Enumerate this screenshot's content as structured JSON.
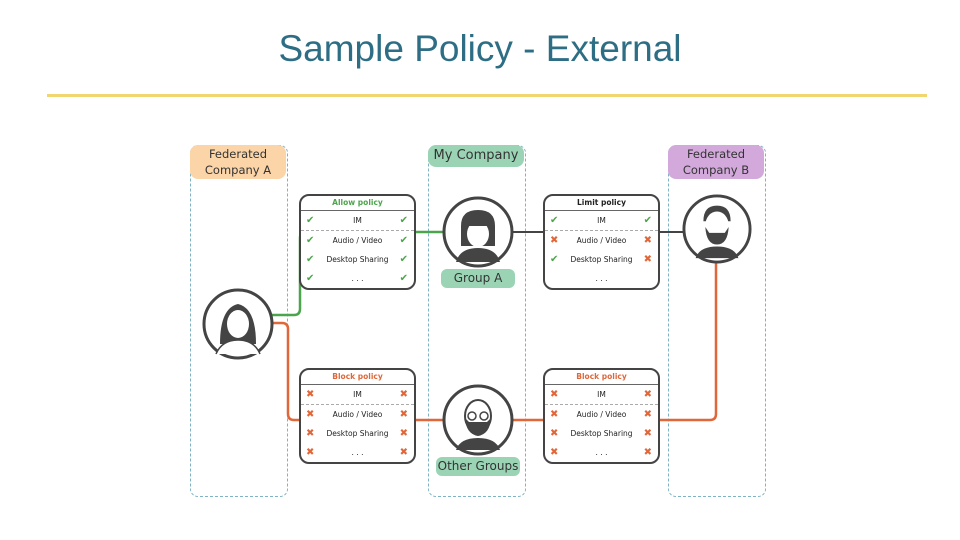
{
  "title": "Sample Policy - External",
  "colors": {
    "title": "#2e6e85",
    "rule": "#f1d56f",
    "allow": "#4ca54c",
    "block": "#e0673a",
    "company_a": "#fbd4a8",
    "my_company": "#9bd4b5",
    "company_b": "#d3a9dc"
  },
  "columns": {
    "company_a": {
      "label_line1": "Federated",
      "label_line2": "Company A"
    },
    "my_company": {
      "label": "My Company"
    },
    "company_b": {
      "label_line1": "Federated",
      "label_line2": "Company B"
    }
  },
  "groups": {
    "group_a": "Group A",
    "other_groups": "Other Groups"
  },
  "policies": {
    "allow": {
      "title": "Allow policy",
      "rows": [
        {
          "label": "IM",
          "left": "check",
          "right": "check"
        },
        {
          "label": "Audio / Video",
          "left": "check",
          "right": "check"
        },
        {
          "label": "Desktop Sharing",
          "left": "check",
          "right": "check"
        },
        {
          "label": ". . .",
          "left": "check",
          "right": "check"
        }
      ]
    },
    "block_a": {
      "title": "Block policy",
      "rows": [
        {
          "label": "IM",
          "left": "cross",
          "right": "cross"
        },
        {
          "label": "Audio / Video",
          "left": "cross",
          "right": "cross"
        },
        {
          "label": "Desktop Sharing",
          "left": "cross",
          "right": "cross"
        },
        {
          "label": ". . .",
          "left": "cross",
          "right": "cross"
        }
      ]
    },
    "limit": {
      "title": "Limit policy",
      "rows": [
        {
          "label": "IM",
          "left": "check",
          "right": "check"
        },
        {
          "label": "Audio / Video",
          "left": "cross",
          "right": "cross"
        },
        {
          "label": "Desktop Sharing",
          "left": "check",
          "right": "cross"
        },
        {
          "label": ". . .",
          "left": "",
          "right": ""
        }
      ]
    },
    "block_b": {
      "title": "Block policy",
      "rows": [
        {
          "label": "IM",
          "left": "cross",
          "right": "cross"
        },
        {
          "label": "Audio / Video",
          "left": "cross",
          "right": "cross"
        },
        {
          "label": "Desktop Sharing",
          "left": "cross",
          "right": "cross"
        },
        {
          "label": ". . .",
          "left": "cross",
          "right": "cross"
        }
      ]
    }
  },
  "marks": {
    "check": "✔",
    "cross": "✖"
  }
}
